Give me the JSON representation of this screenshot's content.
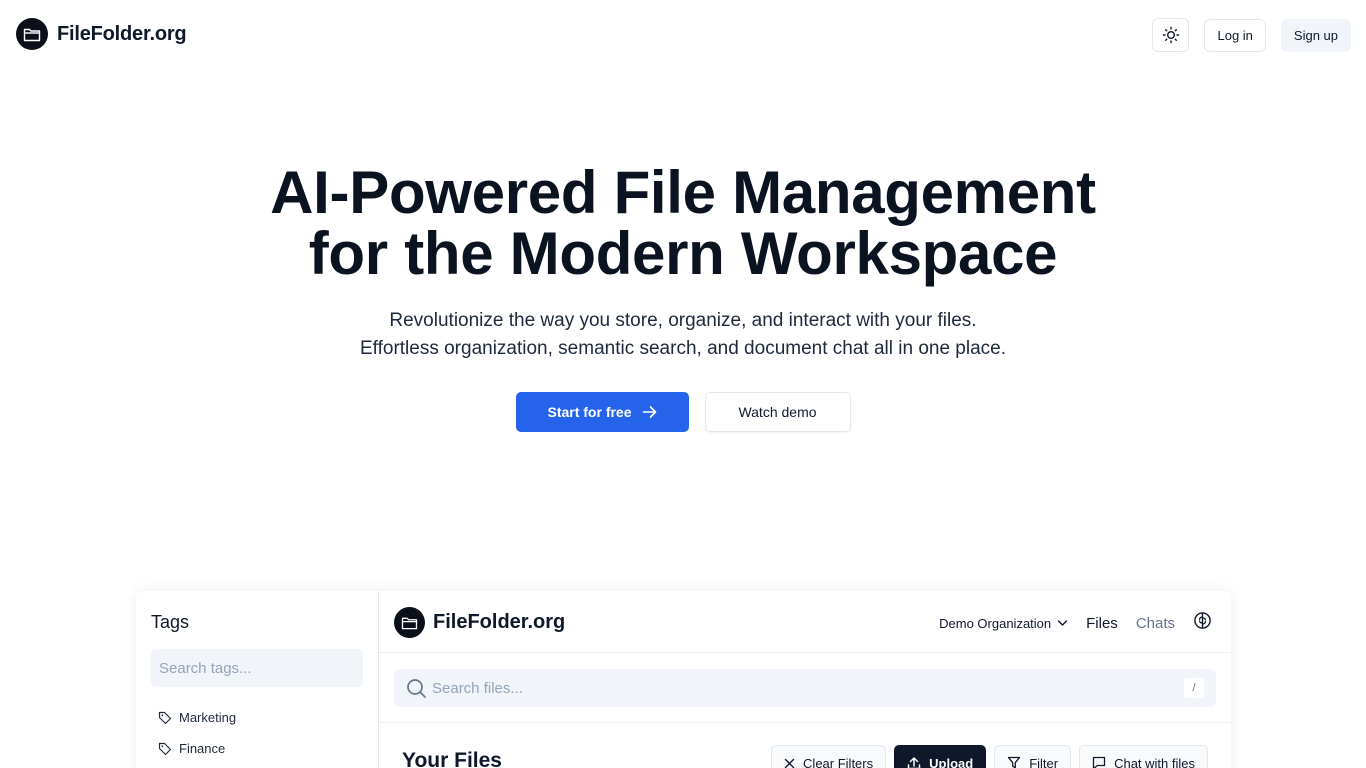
{
  "nav": {
    "brand_name": "FileFolder.org",
    "login_label": "Log in",
    "signup_label": "Sign up"
  },
  "hero": {
    "title_line1": "AI-Powered File Management",
    "title_line2": "for the Modern Workspace",
    "subtitle_line1": "Revolutionize the way you store, organize, and interact with your files.",
    "subtitle_line2": "Effortless organization, semantic search, and document chat all in one place.",
    "start_label": "Start for free",
    "demo_label": "Watch demo"
  },
  "preview": {
    "tags": {
      "title": "Tags",
      "search_placeholder": "Search tags...",
      "items": [
        {
          "label": "Marketing"
        },
        {
          "label": "Finance"
        }
      ]
    },
    "header": {
      "brand_name": "FileFolder.org",
      "org_label": "Demo Organization",
      "files_label": "Files",
      "chats_label": "Chats"
    },
    "search": {
      "placeholder": "Search files...",
      "shortcut": "/"
    },
    "files": {
      "title": "Your Files",
      "clear_filters_label": "Clear Filters",
      "upload_label": "Upload",
      "filter_label": "Filter",
      "chat_label": "Chat with files"
    }
  },
  "colors": {
    "primary": "#2563eb",
    "dark": "#0f172a",
    "muted": "#64748b",
    "input_bg": "#f1f5f9"
  }
}
